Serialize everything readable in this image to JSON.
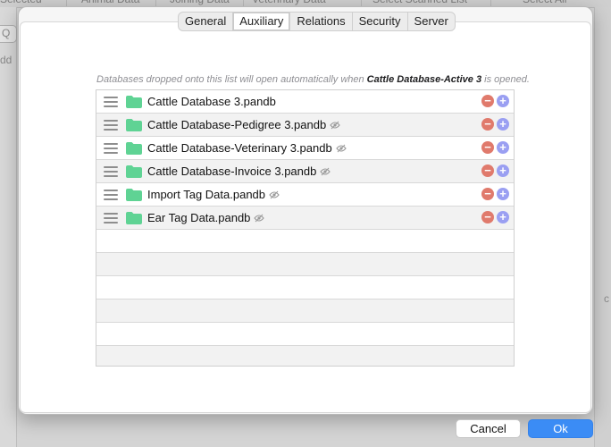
{
  "background": {
    "tabs": [
      "Selected",
      "Animal Data",
      "Joining Data",
      "Veterinary Data",
      "Select Scanned List",
      "Select All"
    ],
    "left_text": "dd",
    "right_text": "c"
  },
  "tabs": [
    {
      "label": "General",
      "selected": false
    },
    {
      "label": "Auxiliary",
      "selected": true
    },
    {
      "label": "Relations",
      "selected": false
    },
    {
      "label": "Security",
      "selected": false
    },
    {
      "label": "Server",
      "selected": false
    }
  ],
  "hint": {
    "prefix": "Databases dropped onto this list will open automatically when ",
    "db_name": "Cattle Database-Active 3",
    "suffix": " is opened."
  },
  "databases": [
    {
      "name": "Cattle Database 3.pandb",
      "hidden": false
    },
    {
      "name": "Cattle Database-Pedigree 3.pandb",
      "hidden": true
    },
    {
      "name": "Cattle Database-Veterinary 3.pandb",
      "hidden": true
    },
    {
      "name": "Cattle Database-Invoice 3.pandb",
      "hidden": true
    },
    {
      "name": "Import Tag Data.pandb",
      "hidden": true
    },
    {
      "name": "Ear Tag Data.pandb",
      "hidden": true
    }
  ],
  "empty_rows": 6,
  "buttons": {
    "cancel": "Cancel",
    "ok": "Ok"
  },
  "colors": {
    "folder": "#5fd394",
    "remove": "#e07a6c",
    "add": "#9a9ff2",
    "accent": "#3b8cf5"
  }
}
